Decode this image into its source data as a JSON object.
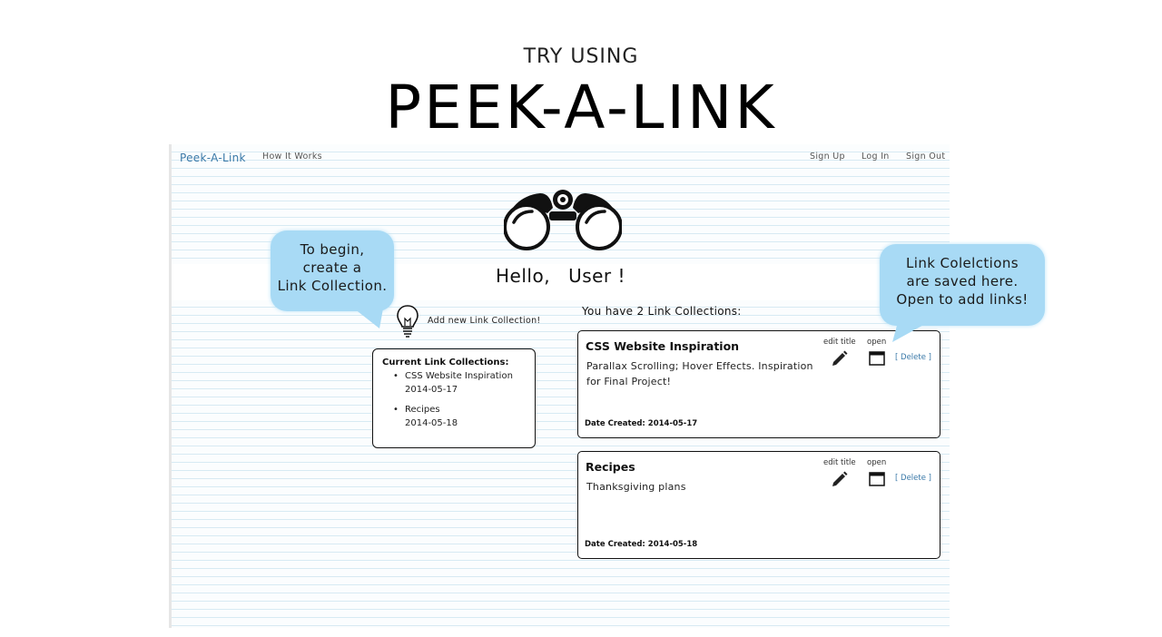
{
  "slide": {
    "kicker": "TRY USING",
    "title": "PEEK-A-LINK"
  },
  "navbar": {
    "brand": "Peek-A-Link",
    "how_it_works": "How It Works",
    "sign_up": "Sign Up",
    "log_in": "Log In",
    "sign_out": "Sign Out"
  },
  "greeting": {
    "hello": "Hello,",
    "name": "User !"
  },
  "add_collection": {
    "label": "Add new Link Collection!"
  },
  "sidebar": {
    "heading": "Current Link Collections:",
    "items": [
      {
        "name": "CSS Website Inspiration",
        "date": "2014-05-17"
      },
      {
        "name": "Recipes",
        "date": "2014-05-18"
      }
    ]
  },
  "main": {
    "count_text": "You have 2 Link Collections:",
    "cards": [
      {
        "title": "CSS Website Inspiration",
        "description": "Parallax Scrolling; Hover Effects. Inspiration for Final Project!",
        "date_label": "Date Created:",
        "date": "2014-05-17",
        "edit_label": "edit title",
        "open_label": "open",
        "delete_label": "[ Delete ]"
      },
      {
        "title": "Recipes",
        "description": "Thanksgiving plans",
        "date_label": "Date Created:",
        "date": "2014-05-18",
        "edit_label": "edit title",
        "open_label": "open",
        "delete_label": "[ Delete ]"
      }
    ]
  },
  "callouts": {
    "left": [
      "To begin,",
      "create a",
      "Link Collection."
    ],
    "right": [
      "Link Colelctions",
      "are saved here.",
      "Open to add links!"
    ]
  },
  "colors": {
    "brand_link": "#3a79a8",
    "bubble_fill": "#a8daf5",
    "ruled_line": "#d7eaf3"
  },
  "icons": [
    "binoculars-icon",
    "lightbulb-icon",
    "pencil-icon",
    "window-icon"
  ]
}
